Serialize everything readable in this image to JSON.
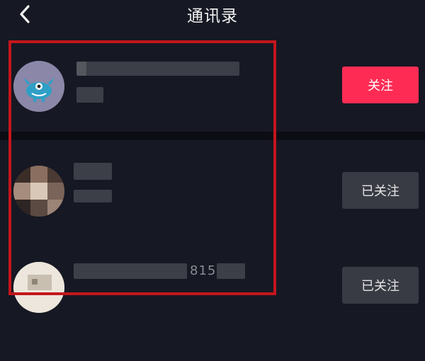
{
  "header": {
    "title": "通讯录",
    "back_icon": "chevron-left-icon"
  },
  "contacts": [
    {
      "button_label": "关注",
      "button_state": "not-following"
    },
    {
      "button_label": "已关注",
      "button_state": "following"
    },
    {
      "button_label": "已关注",
      "button_state": "following",
      "visible_digits": "815"
    }
  ],
  "colors": {
    "background": "#161823",
    "primary_button": "#fe2c55",
    "secondary_button": "#393b44",
    "highlight_border": "#c4161c"
  }
}
